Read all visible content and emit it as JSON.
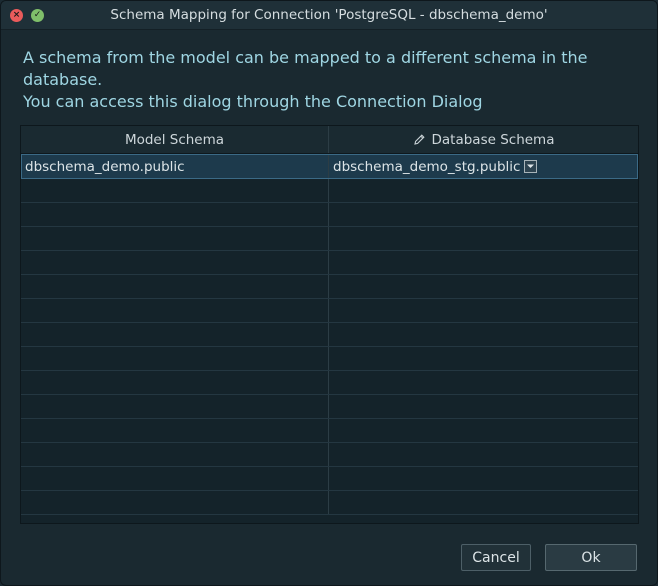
{
  "window": {
    "title": "Schema Mapping for Connection 'PostgreSQL - dbschema_demo'",
    "close_glyph": "×",
    "maximize_glyph": "✓"
  },
  "description": {
    "line1": "A schema from the model can be mapped to a different schema in the database.",
    "line2": "You can access this dialog through the Connection Dialog"
  },
  "table": {
    "columns": [
      {
        "label": "Model Schema"
      },
      {
        "label": "Database Schema",
        "icon": "pencil-icon"
      }
    ],
    "rows": [
      {
        "model_schema": "dbschema_demo.public",
        "database_schema": "dbschema_demo_stg.public"
      }
    ]
  },
  "buttons": {
    "cancel": "Cancel",
    "ok": "Ok"
  },
  "colors": {
    "background": "#1a2930",
    "description_text": "#9fd6e3",
    "selected_row": "#1d3a4c",
    "close_button": "#ea5b5b",
    "maximize_button": "#7fbf6a"
  }
}
